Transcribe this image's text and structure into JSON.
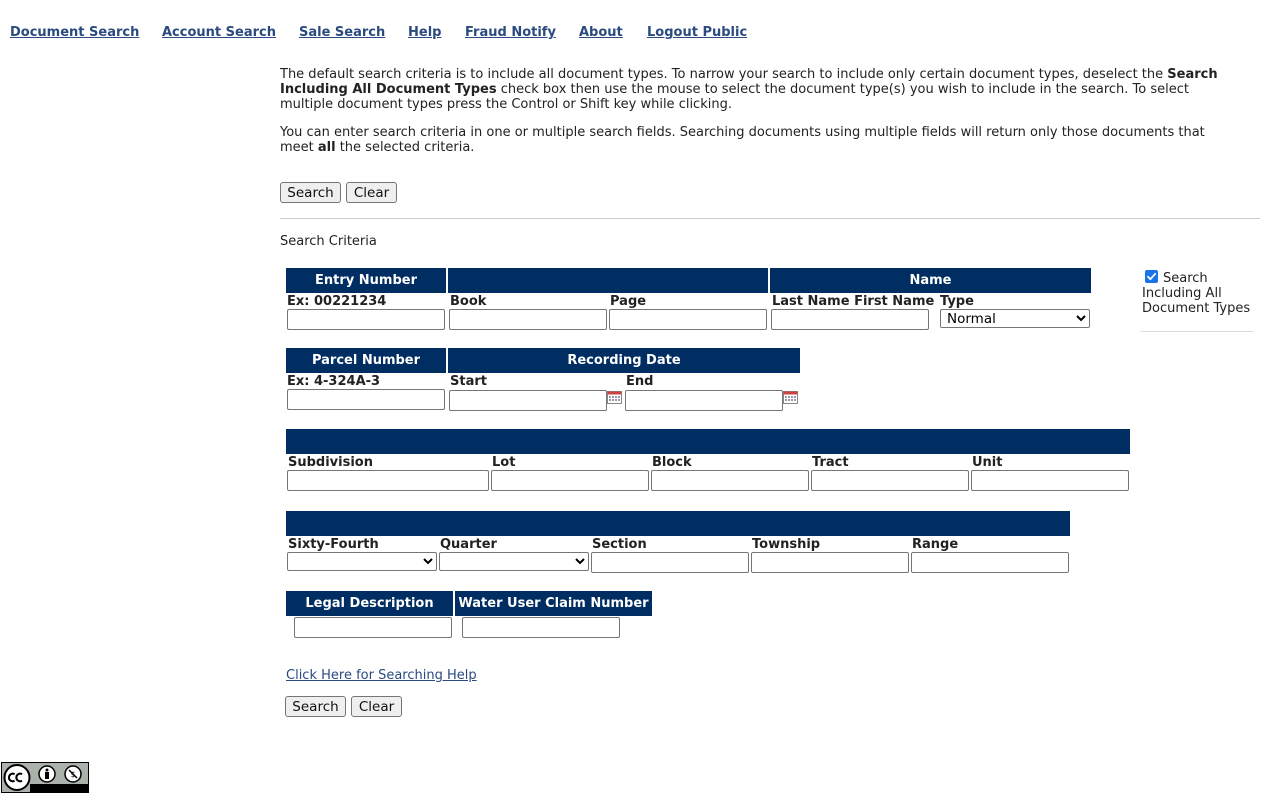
{
  "nav": [
    "Document Search",
    "Account Search",
    "Sale Search",
    "Help",
    "Fraud Notify",
    "About",
    "Logout Public"
  ],
  "intro": {
    "p1_a": "The default search criteria is to include all document types. To narrow your search to include only certain document types, deselect the ",
    "p1_bold": "Search Including All Document Types",
    "p1_b": " check box then use the mouse to select the document type(s) you wish to include in the search. To select multiple document types press the Control or Shift key while clicking.",
    "p2_a": "You can enter search criteria in one or multiple search fields. Searching documents using multiple fields will return only those documents that meet ",
    "p2_bold": "all",
    "p2_b": " the selected criteria."
  },
  "buttons": {
    "search": "Search",
    "clear": "Clear"
  },
  "criteria_title": "Search Criteria",
  "row1": {
    "h_entry": "Entry Number",
    "h_blank": "",
    "h_name": "Name",
    "ex_entry": "Ex: 00221234",
    "book": "Book",
    "page": "Page",
    "last_first": "Last Name First Name",
    "type": "Type",
    "type_value": "Normal"
  },
  "row2": {
    "h_parcel": "Parcel Number",
    "h_recording": "Recording Date",
    "ex_parcel": "Ex: 4-324A-3",
    "start": "Start",
    "end": "End"
  },
  "row3": {
    "subdivision": "Subdivision",
    "lot": "Lot",
    "block": "Block",
    "tract": "Tract",
    "unit": "Unit"
  },
  "row4": {
    "sixty_fourth": "Sixty-Fourth",
    "quarter": "Quarter",
    "section": "Section",
    "township": "Township",
    "range": "Range"
  },
  "row5": {
    "legal": "Legal Description",
    "water": "Water User Claim Number"
  },
  "help_link": "Click Here for Searching Help",
  "checkbox": {
    "label": "Search Including All Document Types",
    "checked": true
  },
  "colors": {
    "header_bg": "#002d62",
    "link": "#2a4a80"
  }
}
